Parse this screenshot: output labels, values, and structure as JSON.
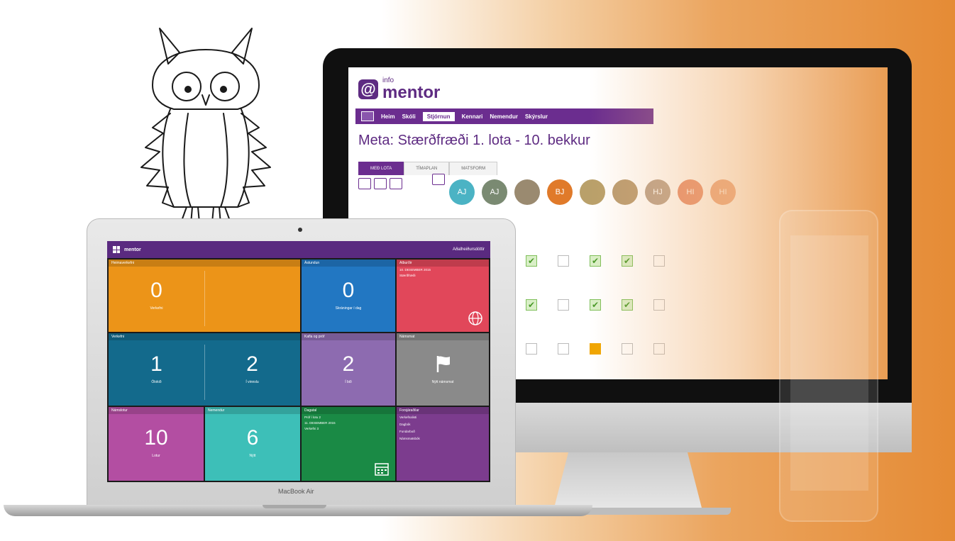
{
  "imac": {
    "logo_small": "info",
    "logo_big": "mentor",
    "nav": [
      "Heim",
      "Skóli",
      "Stjórnun",
      "Kennari",
      "Nemendur",
      "Skýrslur"
    ],
    "nav_active": 2,
    "page_title": "Meta: Stærðfræði 1. lota - 10. bekkur",
    "tabs": [
      "MEÐ LOTA",
      "TÍMAPLAN",
      "MATSFORM"
    ],
    "avatars": [
      {
        "initials": "AJ",
        "color": "#4bb3c4"
      },
      {
        "initials": "AJ",
        "color": "#7a8a72"
      },
      {
        "initials": "",
        "color": "#9a8a70"
      },
      {
        "initials": "BJ",
        "color": "#e07a2a"
      },
      {
        "initials": "",
        "color": "#b9a06a"
      },
      {
        "initials": "",
        "color": "#b99b70"
      },
      {
        "initials": "HJ",
        "color": "#b8a08a"
      },
      {
        "initials": "HI",
        "color": "#e58a6a"
      },
      {
        "initials": "HI",
        "color": "#e9a07a"
      }
    ],
    "apple_logo": ""
  },
  "laptop": {
    "brand_label": "MacBook Air",
    "header": {
      "logo": "mentor",
      "user": "Aðalheiðursdóttir"
    },
    "tiles": {
      "heimaverkefni": {
        "head": "Heimaverkefni",
        "value": "0",
        "label": "Verkefni",
        "color": "#ec9418"
      },
      "astundun": {
        "head": "Ástundun",
        "value": "0",
        "label": "Skráningar í dag",
        "color": "#2277c2"
      },
      "atburdir": {
        "head": "Atburðir",
        "line1": "10. DESEMBER 2015",
        "line2": "Stærðfræði",
        "color": "#e1475a"
      },
      "verkefni": {
        "head": "Verkefni",
        "value1": "1",
        "label1": "Ólokið",
        "value2": "2",
        "label2": "Í vinnslu",
        "color": "#136a8c"
      },
      "kannanir": {
        "head": "Kafla og próf",
        "value": "2",
        "label": "Í bið",
        "color": "#8d6bb0"
      },
      "namsmat": {
        "head": "Námsmat",
        "label": "Nýtt námsmat",
        "color": "#8a8a8a"
      },
      "lotur": {
        "head": "Námslotur",
        "value": "10",
        "label": "Lotur",
        "color": "#b34ea2"
      },
      "nemendur": {
        "head": "Nemendur",
        "value": "6",
        "label": "Nýtt",
        "color": "#3dbfb8"
      },
      "dagatal": {
        "head": "Dagatal",
        "line1": "Próf í lotu 2",
        "line2": "11. DESEMBER 2015",
        "line3": "Verkefni 3",
        "color": "#1a8a45"
      },
      "forsjaradilar": {
        "head": "Forsjáraðilar",
        "items": [
          "Verkefnalisti",
          "Dagbók",
          "Fundarboð",
          "Námsmatsbók"
        ],
        "color": "#7c3c8e"
      }
    }
  }
}
